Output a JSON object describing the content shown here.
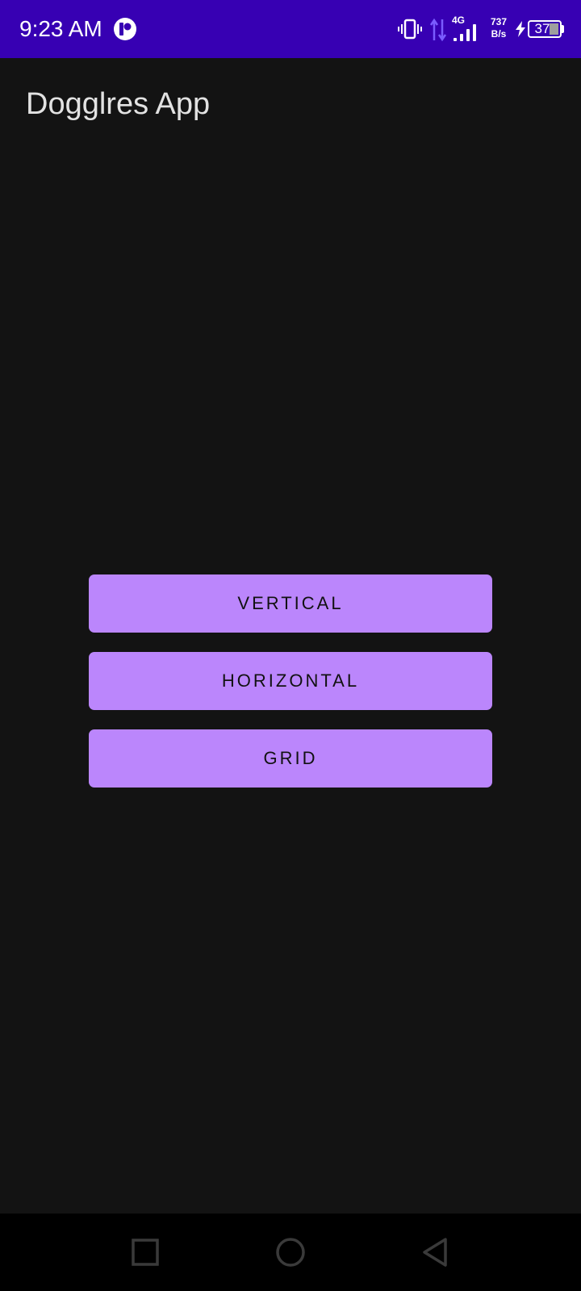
{
  "status_bar": {
    "time": "9:23 AM",
    "network_type": "4G",
    "net_speed_value": "737",
    "net_speed_unit": "B/s",
    "battery_level": "37",
    "icons": [
      "app-notification-icon",
      "vibrate-icon",
      "data-arrows-icon",
      "signal-icon",
      "charging-icon",
      "battery-icon"
    ]
  },
  "app": {
    "title": "Dogglres App"
  },
  "buttons": {
    "vertical": "VERTICAL",
    "horizontal": "HORIZONTAL",
    "grid": "GRID"
  },
  "nav_bar": {
    "icons": [
      "recents-icon",
      "home-icon",
      "back-icon"
    ]
  },
  "colors": {
    "status_bar": "#3700b3",
    "background": "#131313",
    "button": "#bb86fc",
    "button_text": "#111111",
    "title_text": "#e2e2e2",
    "nav_bar": "#000000"
  }
}
